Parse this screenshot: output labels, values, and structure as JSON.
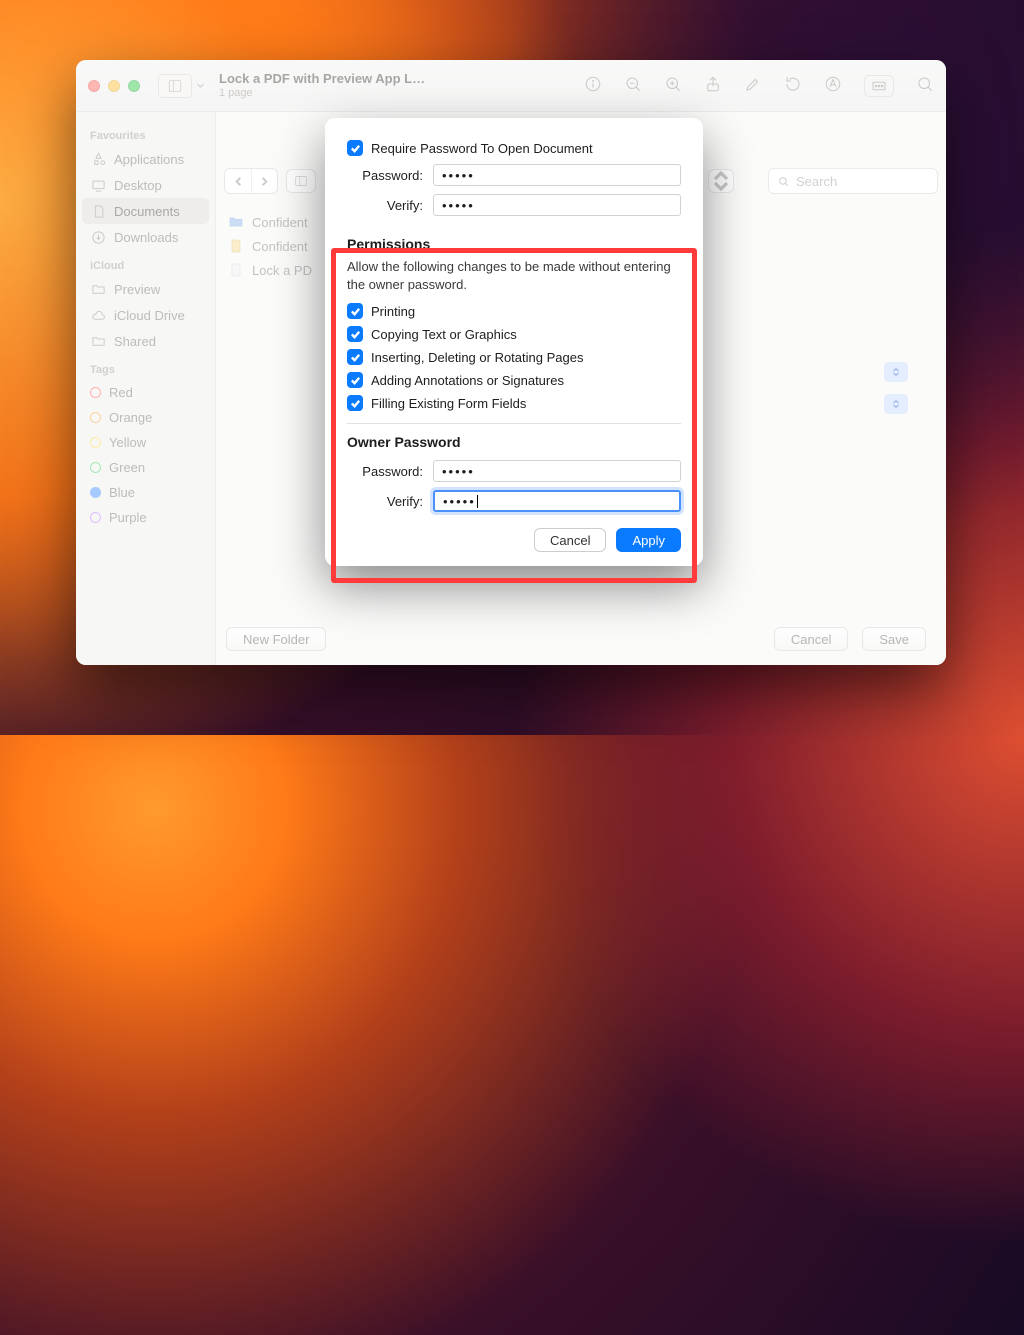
{
  "window": {
    "title": "Lock a PDF with Preview App L…",
    "subtitle": "1 page"
  },
  "sidebar": {
    "sections": [
      {
        "header": "Favourites",
        "items": [
          {
            "label": "Applications",
            "icon": "apps"
          },
          {
            "label": "Desktop",
            "icon": "desktop"
          },
          {
            "label": "Documents",
            "icon": "documents",
            "selected": true
          },
          {
            "label": "Downloads",
            "icon": "downloads"
          }
        ]
      },
      {
        "header": "iCloud",
        "items": [
          {
            "label": "Preview",
            "icon": "folder"
          },
          {
            "label": "iCloud Drive",
            "icon": "cloud"
          },
          {
            "label": "Shared",
            "icon": "shared"
          }
        ]
      },
      {
        "header": "Tags",
        "items": [
          {
            "label": "Red",
            "color": "#ff5650"
          },
          {
            "label": "Orange",
            "color": "#ff9a2e"
          },
          {
            "label": "Yellow",
            "color": "#ffd23a"
          },
          {
            "label": "Green",
            "color": "#3bcf5b"
          },
          {
            "label": "Blue",
            "color": "#3a8bff"
          },
          {
            "label": "Purple",
            "color": "#b76eff"
          }
        ]
      }
    ]
  },
  "save_sheet": {
    "search_placeholder": "Search",
    "files": [
      {
        "label": "Confident",
        "icon": "folder"
      },
      {
        "label": "Confident",
        "icon": "doc"
      },
      {
        "label": "Lock a PD",
        "icon": "doc"
      }
    ],
    "new_folder": "New Folder",
    "cancel": "Cancel",
    "save": "Save"
  },
  "modal": {
    "require_label": "Require Password To Open Document",
    "password_label": "Password:",
    "verify_label": "Verify:",
    "open_password": "•••••",
    "open_verify": "•••••",
    "permissions_header": "Permissions",
    "permissions_sub": "Allow the following changes to be made without entering the owner password.",
    "perms": [
      "Printing",
      "Copying Text or Graphics",
      "Inserting, Deleting or Rotating Pages",
      "Adding Annotations or Signatures",
      "Filling Existing Form Fields"
    ],
    "owner_header": "Owner Password",
    "owner_password": "•••••",
    "owner_verify": "•••••",
    "cancel": "Cancel",
    "apply": "Apply"
  }
}
